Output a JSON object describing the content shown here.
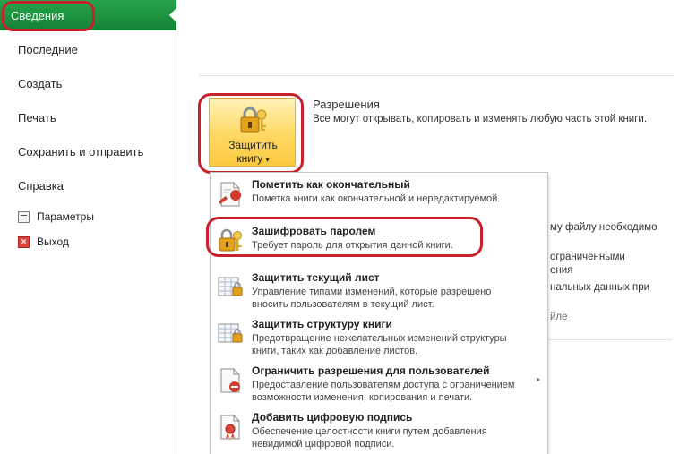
{
  "nav": {
    "active": "Сведения",
    "items": [
      "Последние",
      "Создать",
      "Печать",
      "Сохранить и отправить",
      "Справка"
    ],
    "options_label": "Параметры",
    "exit_label": "Выход"
  },
  "permissions": {
    "title": "Разрешения",
    "description": "Все могут открывать, копировать и изменять любую часть этой книги.",
    "protect_button": {
      "line1": "Защитить",
      "line2": "книгу"
    }
  },
  "background_text": {
    "line1": "му файлу необходимо",
    "line2": "ограниченными",
    "line3": "ения",
    "line4": "нальных данных при",
    "link": "йле"
  },
  "menu": {
    "items": [
      {
        "title": "Пометить как окончательный",
        "desc": [
          "Пометка книги как окончательной и нередактируемой."
        ],
        "icon": "mark-final-icon"
      },
      {
        "title": "Зашифровать паролем",
        "desc": [
          "Требует пароль для открытия данной книги."
        ],
        "icon": "lock-key-icon"
      },
      {
        "title": "Защитить текущий лист",
        "desc": [
          "Управление типами изменений, которые разрешено",
          "вносить пользователям в текущий лист."
        ],
        "icon": "protect-sheet-icon"
      },
      {
        "title": "Защитить структуру книги",
        "desc": [
          "Предотвращение нежелательных изменений структуры",
          "книги, таких как добавление листов."
        ],
        "icon": "protect-structure-icon"
      },
      {
        "title": "Ограничить разрешения для пользователей",
        "desc": [
          "Предоставление пользователям доступа с ограничением",
          "возможности изменения, копирования и печати."
        ],
        "icon": "restrict-permission-icon"
      },
      {
        "title": "Добавить цифровую подпись",
        "desc": [
          "Обеспечение целостности книги путем добавления",
          "невидимой цифровой подписи."
        ],
        "icon": "digital-signature-icon"
      }
    ]
  },
  "colors": {
    "nav_active": "#1f9140",
    "highlight_ring": "#c8202c",
    "button_gold": "#ffd862"
  }
}
